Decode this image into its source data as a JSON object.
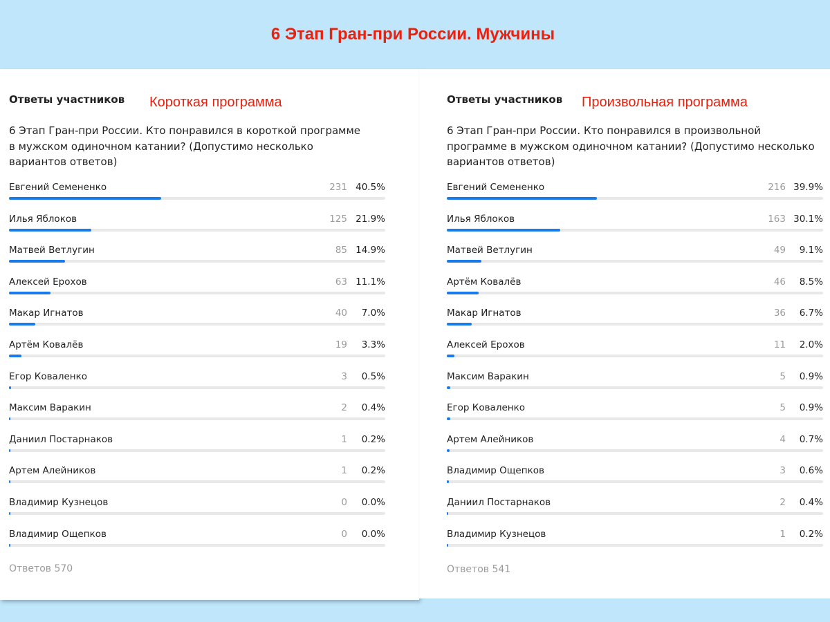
{
  "page_title": "6 Этап Гран-при России. Мужчины",
  "colors": {
    "background": "#bfe6fb",
    "accent_red": "#e8220f",
    "bar_blue": "#1a7be8",
    "bar_track": "#e8e8e8"
  },
  "chart_data": [
    {
      "type": "bar",
      "header": "Ответы участников",
      "tag": "Короткая программа",
      "question": "6 Этап Гран-при России. Кто понравился в короткой программе в мужском одиночном катании? (Допустимо несколько вариантов ответов)",
      "total_label": "Ответов 570",
      "rows": [
        {
          "name": "Евгений Семененко",
          "count": "231",
          "pct": "40.5%",
          "value": 40.5
        },
        {
          "name": "Илья Яблоков",
          "count": "125",
          "pct": "21.9%",
          "value": 21.9
        },
        {
          "name": "Матвей Ветлугин",
          "count": "85",
          "pct": "14.9%",
          "value": 14.9
        },
        {
          "name": "Алексей Ерохов",
          "count": "63",
          "pct": "11.1%",
          "value": 11.1
        },
        {
          "name": "Макар Игнатов",
          "count": "40",
          "pct": "7.0%",
          "value": 7.0
        },
        {
          "name": "Артём Ковалёв",
          "count": "19",
          "pct": "3.3%",
          "value": 3.3
        },
        {
          "name": "Егор Коваленко",
          "count": "3",
          "pct": "0.5%",
          "value": 0.5
        },
        {
          "name": "Максим Варакин",
          "count": "2",
          "pct": "0.4%",
          "value": 0.4
        },
        {
          "name": "Даниил Постарнаков",
          "count": "1",
          "pct": "0.2%",
          "value": 0.2
        },
        {
          "name": "Артем Алейников",
          "count": "1",
          "pct": "0.2%",
          "value": 0.2
        },
        {
          "name": "Владимир Кузнецов",
          "count": "0",
          "pct": "0.0%",
          "value": 0.0
        },
        {
          "name": "Владимир Ощепков",
          "count": "0",
          "pct": "0.0%",
          "value": 0.0
        }
      ]
    },
    {
      "type": "bar",
      "header": "Ответы участников",
      "tag": "Произвольная программа",
      "question": "6 Этап Гран-при России. Кто понравился в произвольной программе в мужском одиночном катании? (Допустимо несколько вариантов ответов)",
      "total_label": "Ответов 541",
      "rows": [
        {
          "name": "Евгений Семененко",
          "count": "216",
          "pct": "39.9%",
          "value": 39.9
        },
        {
          "name": "Илья Яблоков",
          "count": "163",
          "pct": "30.1%",
          "value": 30.1
        },
        {
          "name": "Матвей Ветлугин",
          "count": "49",
          "pct": "9.1%",
          "value": 9.1
        },
        {
          "name": "Артём Ковалёв",
          "count": "46",
          "pct": "8.5%",
          "value": 8.5
        },
        {
          "name": "Макар Игнатов",
          "count": "36",
          "pct": "6.7%",
          "value": 6.7
        },
        {
          "name": "Алексей Ерохов",
          "count": "11",
          "pct": "2.0%",
          "value": 2.0
        },
        {
          "name": "Максим Варакин",
          "count": "5",
          "pct": "0.9%",
          "value": 0.9
        },
        {
          "name": "Егор Коваленко",
          "count": "5",
          "pct": "0.9%",
          "value": 0.9
        },
        {
          "name": "Артем Алейников",
          "count": "4",
          "pct": "0.7%",
          "value": 0.7
        },
        {
          "name": "Владимир Ощепков",
          "count": "3",
          "pct": "0.6%",
          "value": 0.6
        },
        {
          "name": "Даниил Постарнаков",
          "count": "2",
          "pct": "0.4%",
          "value": 0.4
        },
        {
          "name": "Владимир Кузнецов",
          "count": "1",
          "pct": "0.2%",
          "value": 0.2
        }
      ]
    }
  ]
}
